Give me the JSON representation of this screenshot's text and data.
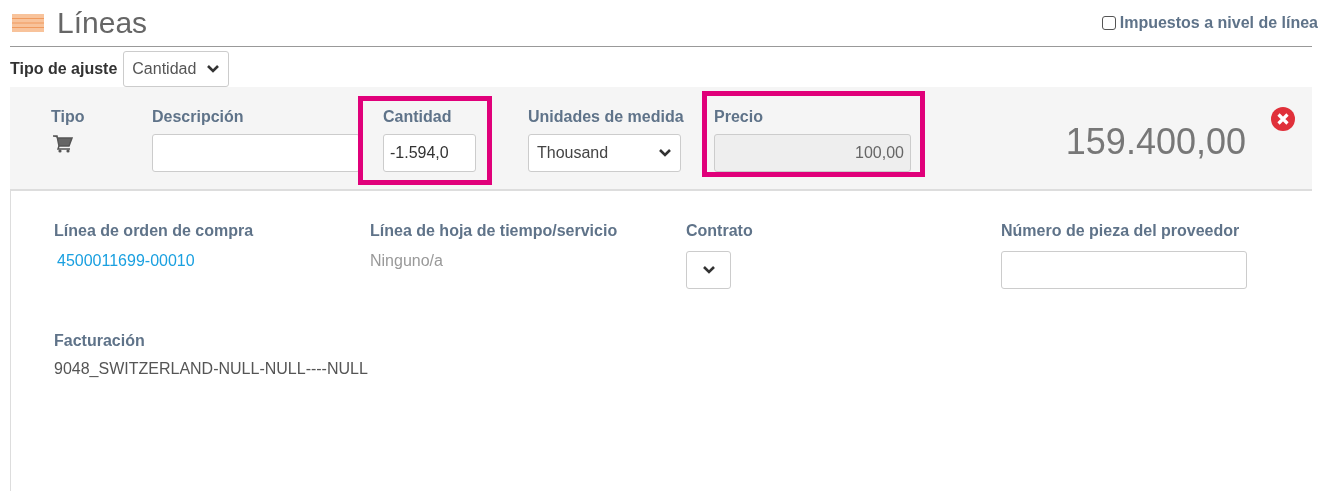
{
  "header": {
    "title": "Líneas",
    "line_level_tax": {
      "label": "Impuestos a nivel de línea",
      "checked": false
    }
  },
  "adjustment": {
    "label": "Tipo de ajuste",
    "value": "Cantidad"
  },
  "line": {
    "type_label": "Tipo",
    "fields": [
      {
        "kind": "input",
        "label": "Descripción"
      },
      {
        "kind": "input",
        "label": "Cantidad",
        "value": "-1.594,0",
        "highlighted": true
      },
      {
        "kind": "select",
        "label": "Unidades de medida",
        "value": "Thousand"
      },
      {
        "kind": "input",
        "label": "Precio",
        "value": "100,00",
        "disabled": true,
        "highlighted": true
      }
    ],
    "total": "159.400,00"
  },
  "details": [
    {
      "kind": "link",
      "label": "Línea de orden de compra",
      "value": "4500011699-00010"
    },
    {
      "kind": "text",
      "label": "Línea de hoja de tiempo/servicio",
      "value": "Ninguno/a"
    },
    {
      "kind": "select",
      "label": "Contrato"
    },
    {
      "kind": "input",
      "label": "Número de pieza del proveedor"
    }
  ],
  "billing": {
    "label": "Facturación",
    "value": "9048_SWITZERLAND-NULL-NULL----NULL"
  }
}
